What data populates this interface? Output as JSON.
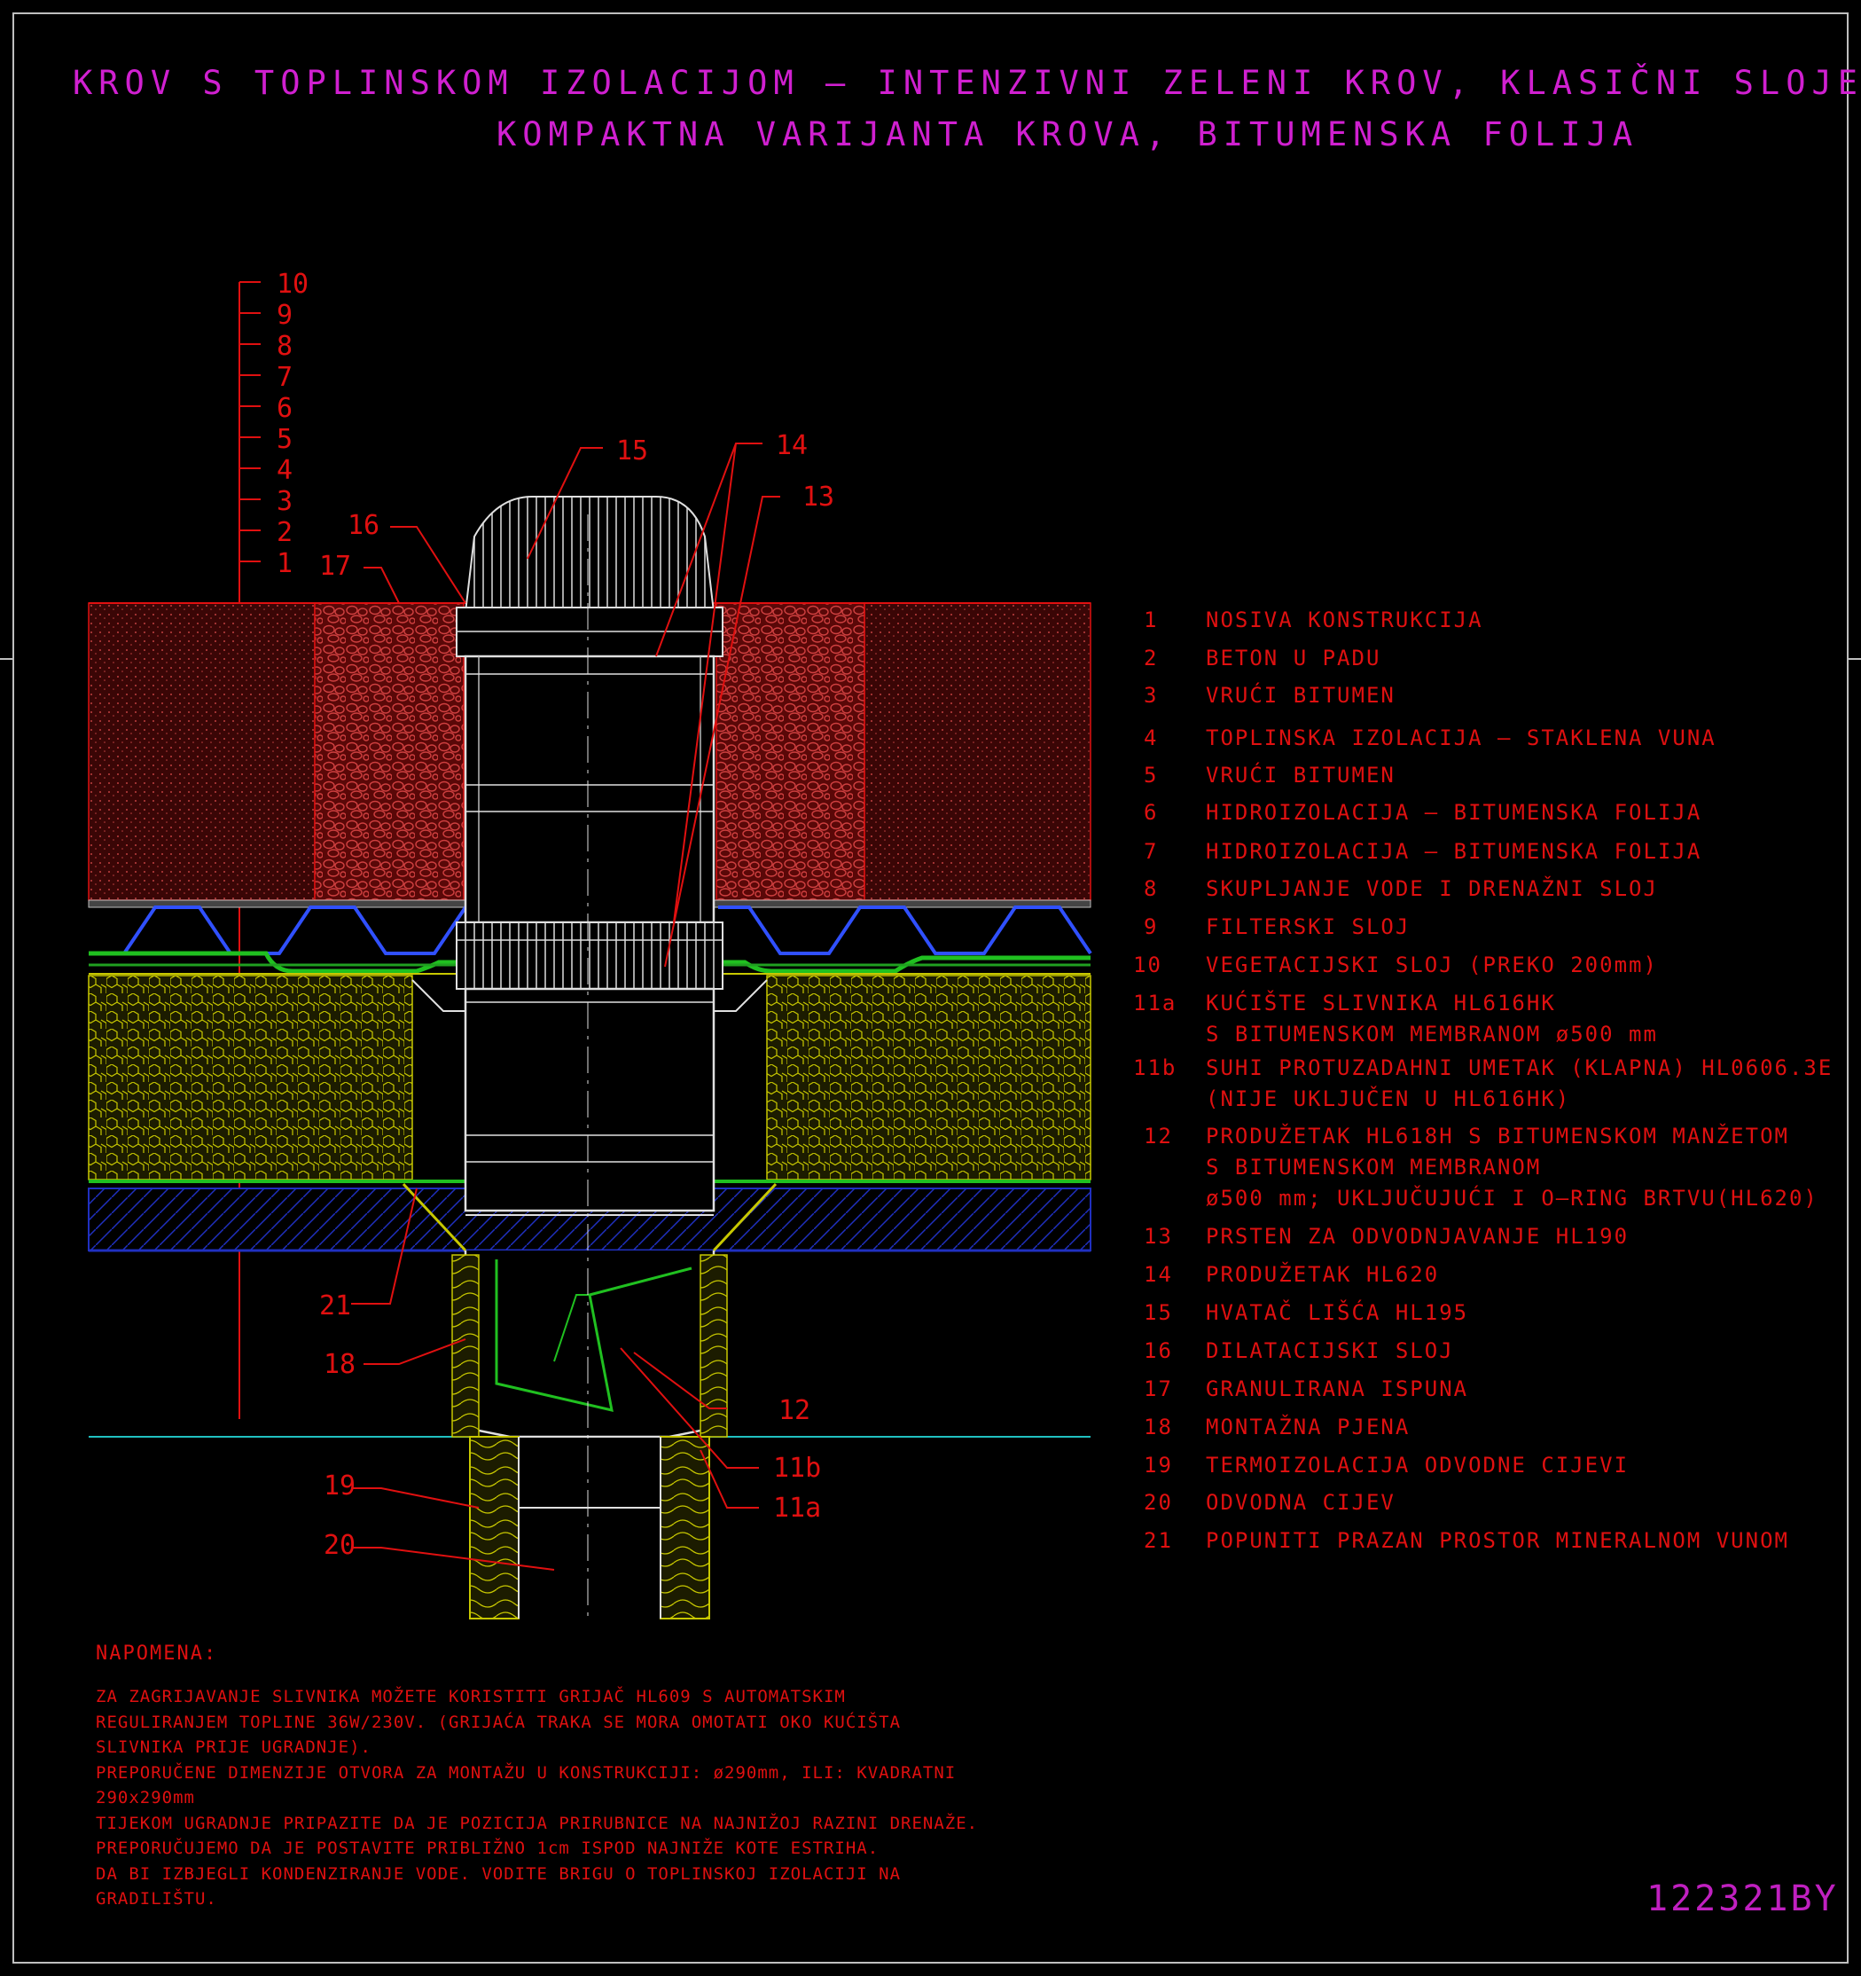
{
  "title": {
    "line1": "KROV S TOPLINSKOM IZOLACIJOM – INTENZIVNI ZELENI KROV, KLASIČNI SLOJEVI,",
    "line2": "KOMPAKTNA VARIJANTA KROVA, BITUMENSKA FOLIJA"
  },
  "scale_labels": [
    "10",
    "9",
    "8",
    "7",
    "6",
    "5",
    "4",
    "3",
    "2",
    "1"
  ],
  "callouts": {
    "c15": "15",
    "c14": "14",
    "c13": "13",
    "c16": "16",
    "c17": "17",
    "c21": "21",
    "c18": "18",
    "c12": "12",
    "c11b": "11b",
    "c11a": "11a",
    "c19": "19",
    "c20": "20"
  },
  "legend": [
    {
      "num": "1",
      "text": "NOSIVA KONSTRUKCIJA"
    },
    {
      "num": "2",
      "text": "BETON U PADU"
    },
    {
      "num": "3",
      "text": "VRUĆI BITUMEN"
    },
    {
      "num": "4",
      "text": "TOPLINSKA IZOLACIJA – STAKLENA VUNA"
    },
    {
      "num": "5",
      "text": "VRUĆI BITUMEN"
    },
    {
      "num": "6",
      "text": "HIDROIZOLACIJA – BITUMENSKA FOLIJA"
    },
    {
      "num": "7",
      "text": "HIDROIZOLACIJA – BITUMENSKA FOLIJA"
    },
    {
      "num": "8",
      "text": "SKUPLJANJE VODE I DRENAŽNI SLOJ"
    },
    {
      "num": "9",
      "text": "FILTERSKI SLOJ"
    },
    {
      "num": "10",
      "text": "VEGETACIJSKI SLOJ (PREKO 200mm)"
    },
    {
      "num": "11a",
      "text": "KUĆIŠTE SLIVNIKA HL616HK"
    },
    {
      "num": "",
      "text": "S BITUMENSKOM MEMBRANOM ø500 mm"
    },
    {
      "num": "11b",
      "text": "SUHI PROTUZADAHNI UMETAK (KLAPNA) HL0606.3E"
    },
    {
      "num": "",
      "text": "(NIJE UKLJUČEN U HL616HK)"
    },
    {
      "num": "12",
      "text": "PRODUŽETAK HL618H S BITUMENSKOM MANŽETOM"
    },
    {
      "num": "",
      "text": "S BITUMENSKOM MEMBRANOM"
    },
    {
      "num": "",
      "text": "ø500 mm; UKLJUČUJUĆI I O–RING BRTVU(HL620)"
    },
    {
      "num": "13",
      "text": "PRSTEN ZA ODVODNJAVANJE HL190"
    },
    {
      "num": "14",
      "text": "PRODUŽETAK HL620"
    },
    {
      "num": "15",
      "text": "HVATAČ LIŠĆA HL195"
    },
    {
      "num": "16",
      "text": "DILATACIJSKI SLOJ"
    },
    {
      "num": "17",
      "text": "GRANULIRANA ISPUNA"
    },
    {
      "num": "18",
      "text": "MONTAŽNA PJENA"
    },
    {
      "num": "19",
      "text": "TERMOIZOLACIJA ODVODNE CIJEVI"
    },
    {
      "num": "20",
      "text": "ODVODNA CIJEV"
    },
    {
      "num": "21",
      "text": "POPUNITI PRAZAN PROSTOR MINERALNOM VUNOM"
    }
  ],
  "notes": {
    "heading": "NAPOMENA:",
    "lines": [
      "ZA ZAGRIJAVANJE SLIVNIKA MOŽETE KORISTITI GRIJAČ HL609 S AUTOMATSKIM",
      "REGULIRANJEM TOPLINE 36W/230V. (GRIJAĆA TRAKA SE MORA OMOTATI OKO KUĆIŠTA",
      "SLIVNIKA PRIJE UGRADNJE).",
      "PREPORUČENE DIMENZIJE OTVORA ZA MONTAŽU U KONSTRUKCIJI: ø290mm, ILI: KVADRATNI",
      "290x290mm",
      "TIJEKOM UGRADNJE PRIPAZITE DA JE POZICIJA PRIRUBNICE NA NAJNIŽOJ RAZINI DRENAŽE.",
      "PREPORUČUJEMO DA JE POSTAVITE PRIBLIŽNO 1cm ISPOD NAJNIŽE KOTE ESTRIHA.",
      "DA BI IZBJEGLI KONDENZIRANJE VODE. VODITE BRIGU O TOPLINSKOJ IZOLACIJI NA",
      "GRADILIŠTU."
    ]
  },
  "drawing_code": "122321BY",
  "colors": {
    "background": "#000000",
    "title": "#d020d0",
    "text": "#e01010",
    "soil": "#8a1010",
    "insulation": "#c8c800",
    "membrane": "#20a020",
    "concrete": "#2030c0",
    "frame": "#bfbfbf"
  }
}
